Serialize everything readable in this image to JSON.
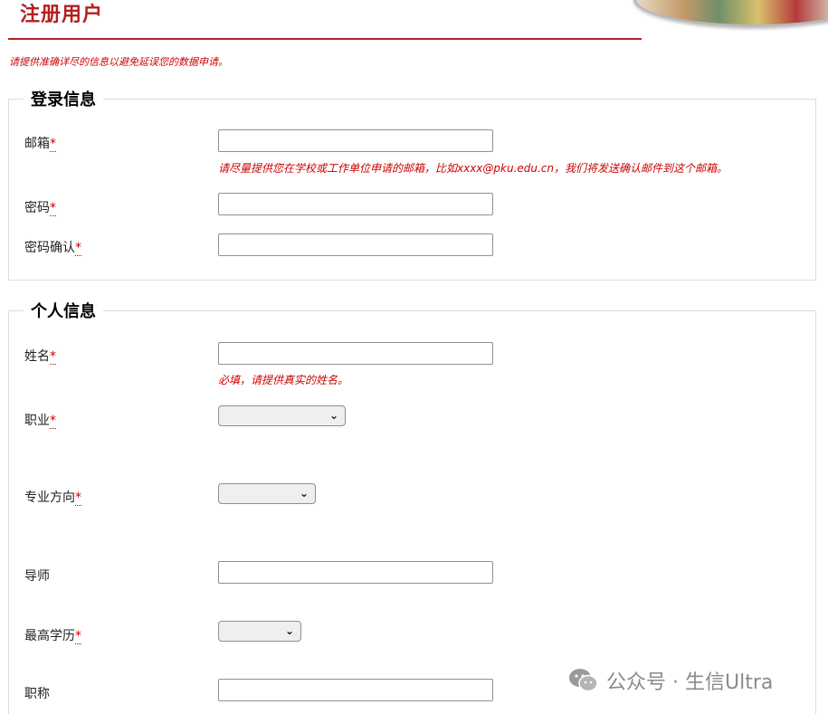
{
  "page": {
    "title": "注册用户",
    "notice": "请提供准确详尽的信息以避免延误您的数据申请。"
  },
  "login_section": {
    "legend": "登录信息",
    "email": {
      "label": "邮箱",
      "required_mark": "*",
      "value": "",
      "hint": "请尽量提供您在学校或工作单位申请的邮箱，比如xxxx@pku.edu.cn，我们将发送确认邮件到这个邮箱。"
    },
    "password": {
      "label": "密码",
      "required_mark": "*",
      "value": ""
    },
    "password_confirm": {
      "label": "密码确认",
      "required_mark": "*",
      "value": ""
    }
  },
  "personal_section": {
    "legend": "个人信息",
    "name": {
      "label": "姓名",
      "required_mark": "*",
      "value": "",
      "hint": "必填，请提供真实的姓名。"
    },
    "occupation": {
      "label": "职业",
      "required_mark": "*",
      "selected": ""
    },
    "major": {
      "label": "专业方向",
      "required_mark": "*",
      "selected": ""
    },
    "advisor": {
      "label": "导师",
      "value": ""
    },
    "education": {
      "label": "最高学历",
      "required_mark": "*",
      "selected": ""
    },
    "title_field": {
      "label": "职称",
      "value": ""
    }
  },
  "watermark": {
    "text": "公众号 · 生信Ultra",
    "icon": "wechat-icon"
  },
  "colors": {
    "accent": "#b42020",
    "required": "#cc0000"
  }
}
